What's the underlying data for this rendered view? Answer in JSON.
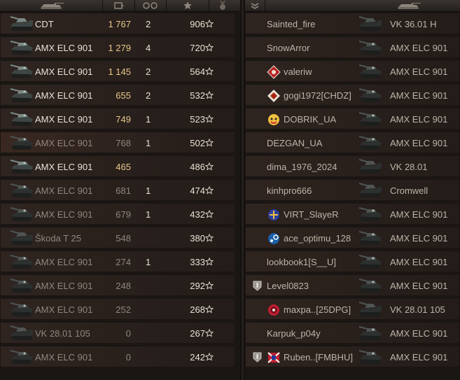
{
  "left_team": {
    "rows": [
      {
        "tank": "CDT",
        "damage": "1 767",
        "kills": "2",
        "score": "906",
        "alive": true,
        "tank_icon": "cdt-tank-icon"
      },
      {
        "tank": "AMX ELC 901",
        "damage": "1 279",
        "kills": "4",
        "score": "720",
        "alive": true,
        "tank_icon": "amx-elc-tank-icon"
      },
      {
        "tank": "AMX ELC 901",
        "damage": "1 145",
        "kills": "2",
        "score": "564",
        "alive": true,
        "tank_icon": "amx-elc-tank-icon"
      },
      {
        "tank": "AMX ELC 901",
        "damage": "655",
        "kills": "2",
        "score": "532",
        "alive": true,
        "tank_icon": "amx-elc-tank-icon"
      },
      {
        "tank": "AMX ELC 901",
        "damage": "749",
        "kills": "1",
        "score": "523",
        "alive": true,
        "tank_icon": "amx-elc-tank-icon"
      },
      {
        "tank": "AMX ELC 901",
        "damage": "768",
        "kills": "1",
        "score": "502",
        "alive": false,
        "tank_icon": "amx-elc-tank-icon"
      },
      {
        "tank": "AMX ELC 901",
        "damage": "465",
        "kills": "",
        "score": "486",
        "alive": true,
        "tank_icon": "amx-elc-tank-icon"
      },
      {
        "tank": "AMX ELC 901",
        "damage": "681",
        "kills": "1",
        "score": "474",
        "alive": false,
        "tank_icon": "amx-elc-tank-icon"
      },
      {
        "tank": "AMX ELC 901",
        "damage": "679",
        "kills": "1",
        "score": "432",
        "alive": false,
        "tank_icon": "amx-elc-tank-icon"
      },
      {
        "tank": "Škoda T 25",
        "damage": "548",
        "kills": "",
        "score": "380",
        "alive": false,
        "tank_icon": "skoda-t25-tank-icon"
      },
      {
        "tank": "AMX ELC 901",
        "damage": "274",
        "kills": "1",
        "score": "333",
        "alive": false,
        "tank_icon": "amx-elc-tank-icon"
      },
      {
        "tank": "AMX ELC 901",
        "damage": "248",
        "kills": "",
        "score": "292",
        "alive": false,
        "tank_icon": "amx-elc-tank-icon"
      },
      {
        "tank": "AMX ELC 901",
        "damage": "252",
        "kills": "",
        "score": "268",
        "alive": false,
        "tank_icon": "amx-elc-tank-icon"
      },
      {
        "tank": "VK 28.01 105",
        "damage": "0",
        "kills": "",
        "score": "267",
        "alive": false,
        "tank_icon": "vk2801-tank-icon"
      },
      {
        "tank": "AMX ELC 901",
        "damage": "0",
        "kills": "",
        "score": "242",
        "alive": false,
        "tank_icon": "amx-elc-tank-icon"
      }
    ]
  },
  "right_team": {
    "rows": [
      {
        "player": "Sainted_fire",
        "tank": "VK 36.01 H",
        "badge": "",
        "rank": false,
        "tank_icon": "vk3601h-tank-icon"
      },
      {
        "player": "SnowArror",
        "tank": "AMX ELC 901",
        "badge": "",
        "rank": false,
        "tank_icon": "amx-elc-tank-icon"
      },
      {
        "player": "valeriw",
        "tank": "AMX ELC 901",
        "badge": "red-diamond-clan-icon",
        "rank": false,
        "tank_icon": "amx-elc-tank-icon"
      },
      {
        "player": "gogi1972[CHDZ]",
        "tank": "AMX ELC 901",
        "badge": "white-diamond-clan-icon",
        "rank": false,
        "tank_icon": "amx-elc-tank-icon"
      },
      {
        "player": "DOBRIK_UA",
        "tank": "AMX ELC 901",
        "badge": "mascot-clan-icon",
        "rank": false,
        "tank_icon": "amx-elc-tank-icon"
      },
      {
        "player": "DEZGAN_UA",
        "tank": "AMX ELC 901",
        "badge": "",
        "rank": false,
        "tank_icon": "amx-elc-tank-icon"
      },
      {
        "player": "dima_1976_2024",
        "tank": "VK 28.01",
        "badge": "",
        "rank": false,
        "tank_icon": "vk2801-tank-icon"
      },
      {
        "player": "kinhpro666",
        "tank": "Cromwell",
        "badge": "",
        "rank": false,
        "tank_icon": "cromwell-tank-icon"
      },
      {
        "player": "VIRT_SlayeR",
        "tank": "AMX ELC 901",
        "badge": "virt-clan-icon",
        "rank": false,
        "tank_icon": "amx-elc-tank-icon"
      },
      {
        "player": "ace_optimu_128",
        "tank": "AMX ELC 901",
        "badge": "steam-clan-icon",
        "rank": false,
        "tank_icon": "amx-elc-tank-icon"
      },
      {
        "player": "lookbook1[S__U]",
        "tank": "AMX ELC 901",
        "badge": "",
        "rank": false,
        "tank_icon": "amx-elc-tank-icon"
      },
      {
        "player": "Level0823",
        "tank": "AMX ELC 901",
        "badge": "",
        "rank": true,
        "tank_icon": "amx-elc-tank-icon"
      },
      {
        "player": "maxpa..[25DPG]",
        "tank": "VK 28.01 105",
        "badge": "red-target-clan-icon",
        "rank": false,
        "tank_icon": "vk2801-tank-icon"
      },
      {
        "player": "Karpuk_p04y",
        "tank": "AMX ELC 901",
        "badge": "",
        "rank": false,
        "tank_icon": "amx-elc-tank-icon"
      },
      {
        "player": "Ruben..[FMBHU]",
        "tank": "AMX ELC 901",
        "badge": "flag-clan-icon",
        "rank": true,
        "tank_icon": "amx-elc-tank-icon"
      }
    ]
  },
  "colors": {
    "alive_text": "#e8e2d4",
    "dead_text": "#8f877d",
    "damage_highlight": "#e6c98a"
  },
  "header_icons": [
    "tank-header-icon",
    "damage-header-icon",
    "kills-header-icon",
    "score-star-header-icon",
    "medal-header-icon",
    "rank-header-icon",
    "tank-header-icon"
  ]
}
